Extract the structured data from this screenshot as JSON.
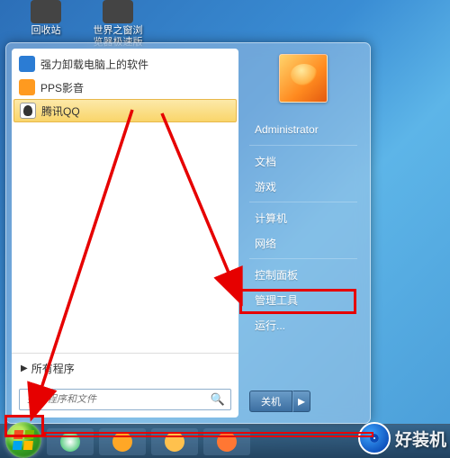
{
  "desktop": {
    "icons": [
      {
        "label": "回收站"
      },
      {
        "label": "世界之窗浏\n览器极速版"
      }
    ]
  },
  "start_menu": {
    "left": {
      "programs": [
        {
          "label": "强力卸载电脑上的软件",
          "icon": "uninstall"
        },
        {
          "label": "PPS影音",
          "icon": "pps"
        },
        {
          "label": "腾讯QQ",
          "icon": "qq",
          "selected": true
        }
      ],
      "all_programs": "所有程序",
      "search_placeholder": "搜索程序和文件"
    },
    "right": {
      "user": "Administrator",
      "items": [
        "文档",
        "游戏",
        "计算机",
        "网络",
        "控制面板",
        "管理工具",
        "运行..."
      ],
      "highlighted": "控制面板",
      "shutdown_label": "关机"
    }
  },
  "watermark": "好装机"
}
